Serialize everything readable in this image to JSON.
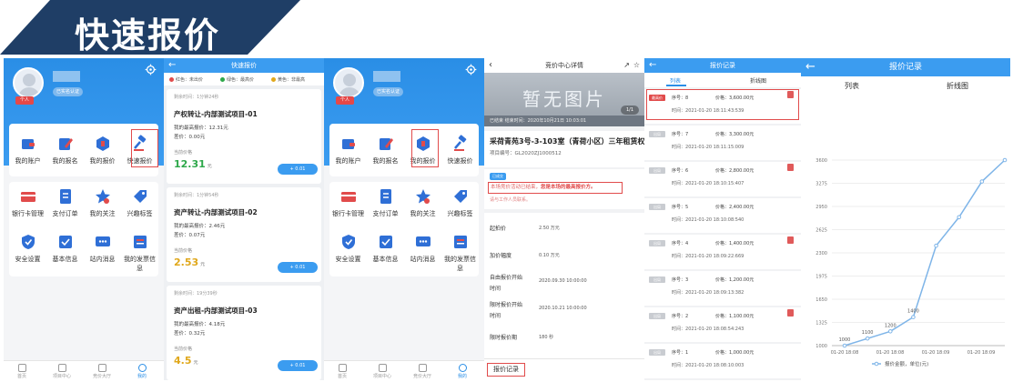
{
  "banner": {
    "title": "快速报价",
    "color": "#1f3e66"
  },
  "accent": "#3b9cf0",
  "highlight_color": "#e14b4b",
  "account": {
    "user_tag": "个人",
    "cert_badge": "已实名认证",
    "grid_top": [
      {
        "label": "我的账户",
        "icon": "wallet-icon"
      },
      {
        "label": "我的报名",
        "icon": "edit-icon"
      },
      {
        "label": "我的报价",
        "icon": "quote-icon"
      },
      {
        "label": "快速报价",
        "icon": "gavel-icon"
      }
    ],
    "grid_bottom": [
      {
        "label": "银行卡管理",
        "icon": "card-icon"
      },
      {
        "label": "支付订单",
        "icon": "order-icon"
      },
      {
        "label": "我的关注",
        "icon": "star-icon"
      },
      {
        "label": "兴趣标签",
        "icon": "tag-icon"
      },
      {
        "label": "安全设置",
        "icon": "shield-icon"
      },
      {
        "label": "基本信息",
        "icon": "info-icon"
      },
      {
        "label": "站内消息",
        "icon": "message-icon"
      },
      {
        "label": "我的发票信息",
        "icon": "invoice-icon"
      }
    ],
    "tabs": [
      "首页",
      "项目中心",
      "竞价大厅",
      "我的"
    ]
  },
  "quick_quote": {
    "title": "快速报价",
    "legend": [
      "红色：未出价",
      "绿色：最高价",
      "黄色：非最高"
    ],
    "cards": [
      {
        "time": "剩余时间：1分钟24秒",
        "title": "产权转让-内部测试项目-01",
        "highest_label": "我的最高报价：",
        "highest": "12.31元",
        "diff_label": "差价：",
        "diff": "0.00元",
        "cur_label": "当前价格",
        "price": "12.31",
        "unit": "元",
        "price_color": "#2ea84a",
        "button": "+ 0.01"
      },
      {
        "time": "剩余时间：1分钟54秒",
        "title": "资产转让-内部测试项目-02",
        "highest_label": "我的最高报价：",
        "highest": "2.46元",
        "diff_label": "差价：",
        "diff": "0.07元",
        "cur_label": "当前价格",
        "price": "2.53",
        "unit": "元",
        "price_color": "#e0a81c",
        "button": "+ 0.01"
      },
      {
        "time": "剩余时间：19分39秒",
        "title": "资产出租-内部测试项目-03",
        "highest_label": "我的最高报价：",
        "highest": "4.18元",
        "diff_label": "差价：",
        "diff": "0.32元",
        "cur_label": "当前价格",
        "price": "4.5",
        "unit": "元",
        "price_color": "#e0a81c",
        "button": "+ 0.01"
      }
    ]
  },
  "detail": {
    "nav_title": "竞价中心详情",
    "image_placeholder": "暂无图片",
    "page_indicator": "1/1",
    "status_strip": "已结束   结束时间：2020年10月21日 10:03:01",
    "title": "采荷青苑3号-3-103室（青荷小区）三年租赁权",
    "code": "项目编号：GL2020ZJ1000512",
    "tag": "已成交",
    "notice_prefix": "本场竞价活动已结束，",
    "notice_bold": "您是本场的最高报价方。",
    "notice_line2": "请与工作人员联系。",
    "rows": [
      {
        "label": "起拍价",
        "value": "2.50 万元"
      },
      {
        "label": "加价幅度",
        "value": "0.10 万元"
      },
      {
        "label": "自由报价开始\n时间",
        "value": "2020.09.30 10:00:00"
      },
      {
        "label": "限时报价开始\n时间",
        "value": "2020.10.21 10:00:00"
      },
      {
        "label": "限时报价期",
        "value": "180 秒"
      }
    ],
    "footer_button": "报价记录"
  },
  "records": {
    "title": "报价记录",
    "tabs": [
      "列表",
      "折线图"
    ],
    "seq_label": "序号：",
    "price_label": "价格：",
    "time_label": "时间：",
    "top_badge": "最高价",
    "out_badge": "出局",
    "items": [
      {
        "seq": "8",
        "price": "3,600.00元",
        "time": "2021-01-20    18:11:43:539",
        "top": true,
        "flag": true
      },
      {
        "seq": "7",
        "price": "3,300.00元",
        "time": "2021-01-20    18:11:15:009",
        "top": false,
        "flag": false
      },
      {
        "seq": "6",
        "price": "2,800.00元",
        "time": "2021-01-20    18:10:15:407",
        "top": false,
        "flag": true
      },
      {
        "seq": "5",
        "price": "2,400.00元",
        "time": "2021-01-20    18:10:08:540",
        "top": false,
        "flag": false
      },
      {
        "seq": "4",
        "price": "1,400.00元",
        "time": "2021-01-20    18:09:22:669",
        "top": false,
        "flag": true
      },
      {
        "seq": "3",
        "price": "1,200.00元",
        "time": "2021-01-20    18:09:13:382",
        "top": false,
        "flag": false
      },
      {
        "seq": "2",
        "price": "1,100.00元",
        "time": "2021-01-20    18:08:54:243",
        "top": false,
        "flag": true
      },
      {
        "seq": "1",
        "price": "1,000.00元",
        "time": "2021-01-20    18:08:10:003",
        "top": false,
        "flag": false
      }
    ]
  },
  "chart_data": {
    "type": "line",
    "title": "报价记录",
    "tabs": [
      "列表",
      "折线图"
    ],
    "categories": [
      "01-20 18:08",
      "01-20 18:08",
      "01-20 18:09",
      "01-20 18:09"
    ],
    "x": [
      0,
      1,
      2,
      3,
      4,
      5,
      6,
      7
    ],
    "values": [
      1000,
      1100,
      1200,
      1400,
      2400,
      2800,
      3300,
      3600
    ],
    "point_labels": [
      "1000",
      "1100",
      "1200",
      "1400"
    ],
    "yticks": [
      1000,
      1325,
      1650,
      1975,
      2300,
      2625,
      2950,
      3275,
      3600
    ],
    "ylim": [
      1000,
      3600
    ],
    "legend": "报价金额，单位(元)",
    "legend_position": "bottom",
    "line_color": "#7fb5e8",
    "grid": true
  }
}
